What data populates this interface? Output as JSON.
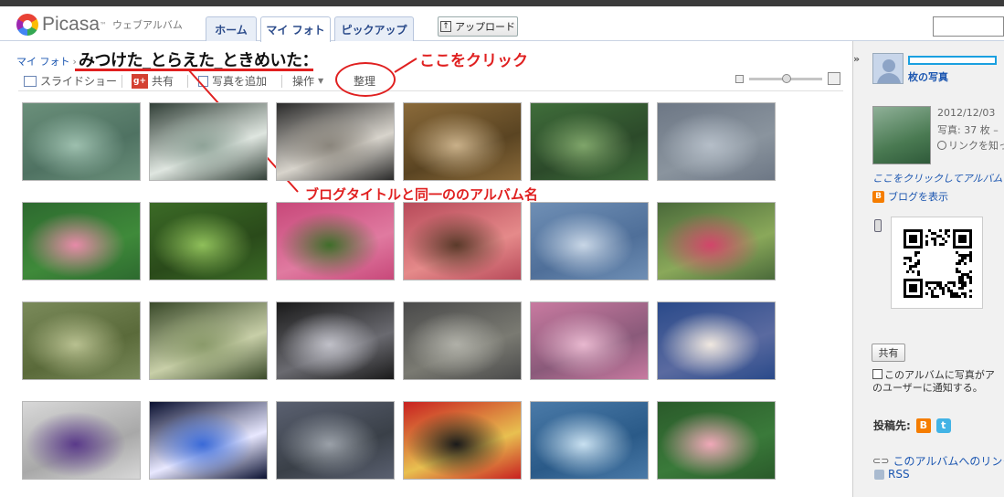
{
  "header": {
    "logo_text": "Picasa",
    "logo_tm": "™",
    "logo_sub": "ウェブアルバム",
    "tabs": [
      "ホーム",
      "マイ フォト",
      "ピックアップ"
    ],
    "upload_label": "アップロード"
  },
  "breadcrumb": {
    "root": "マイ フォト",
    "separator": "›"
  },
  "album": {
    "title": "みつけた_とらえた_ときめいた："
  },
  "toolbar": {
    "slideshow": "スライドショー",
    "share_icon": "g+",
    "share": "共有",
    "add_photos": "写真を追加",
    "actions": "操作",
    "organize": "整理"
  },
  "annotations": {
    "click_here": "ここをクリック",
    "blog_title_note": "ブログタイトルと同一ののアルバム名"
  },
  "photos": [
    {
      "desc": "green-stream",
      "colors": [
        "#6a8f7a",
        "#9dbfae",
        "#4f7262"
      ]
    },
    {
      "desc": "waterfall-splash",
      "colors": [
        "#324038",
        "#8fa398",
        "#dfe6e0"
      ]
    },
    {
      "desc": "rock-cascade",
      "colors": [
        "#2a2a2a",
        "#8a857c",
        "#d8d4cc"
      ]
    },
    {
      "desc": "golden-water",
      "colors": [
        "#8a6a3a",
        "#c9b089",
        "#5a4422"
      ]
    },
    {
      "desc": "reflecting-pond",
      "colors": [
        "#3f6d3a",
        "#7fa56a",
        "#2c4a2a"
      ]
    },
    {
      "desc": "cloud-reflection",
      "colors": [
        "#6d7785",
        "#b5bec8",
        "#8a949e"
      ]
    },
    {
      "desc": "pink-lotus",
      "colors": [
        "#2d6a2f",
        "#e78aa8",
        "#3f8a3a"
      ]
    },
    {
      "desc": "green-forest",
      "colors": [
        "#3b6a26",
        "#8fbf5a",
        "#2a4a1a"
      ]
    },
    {
      "desc": "azalea-bush",
      "colors": [
        "#c8487a",
        "#3f6e2a",
        "#e07aa0"
      ]
    },
    {
      "desc": "azalea-trunk",
      "colors": [
        "#b84a5a",
        "#5a3a2a",
        "#e58a8a"
      ]
    },
    {
      "desc": "cirrus-sky",
      "colors": [
        "#6f8fb5",
        "#c8d6e6",
        "#4f6f99"
      ]
    },
    {
      "desc": "hillside-blossoms",
      "colors": [
        "#4a6a3a",
        "#d2456a",
        "#8aa85a"
      ]
    },
    {
      "desc": "spring-trees",
      "colors": [
        "#7a8a5a",
        "#b8c090",
        "#5a6a3a"
      ]
    },
    {
      "desc": "mossy-branches",
      "colors": [
        "#3a4a2a",
        "#8a9a6a",
        "#c8cfa8"
      ]
    },
    {
      "desc": "petals-dark",
      "colors": [
        "#1a1a1a",
        "#c0c0c8",
        "#6a6a70"
      ]
    },
    {
      "desc": "petals-water",
      "colors": [
        "#4a4a4a",
        "#b0b0a8",
        "#7a7a72"
      ]
    },
    {
      "desc": "weeping-cherry",
      "colors": [
        "#c87aa0",
        "#e8b8cf",
        "#8a5a7a"
      ]
    },
    {
      "desc": "white-magnolia",
      "colors": [
        "#2a4a8a",
        "#f0e8e0",
        "#5a6aa0"
      ]
    },
    {
      "desc": "purple-ribbon",
      "colors": [
        "#d8d8d8",
        "#5a3a8a",
        "#a8a8a8"
      ]
    },
    {
      "desc": "castle-night",
      "colors": [
        "#0a1030",
        "#3a6ad8",
        "#e8e8ff"
      ]
    },
    {
      "desc": "shadows-pavement",
      "colors": [
        "#5a6070",
        "#9aa0a8",
        "#3a4048"
      ]
    },
    {
      "desc": "mickey-minnie",
      "colors": [
        "#c82020",
        "#1a1a1a",
        "#e8c050"
      ]
    },
    {
      "desc": "frosted-conifer",
      "colors": [
        "#4a7aa8",
        "#c8e0f0",
        "#2a5a88"
      ]
    },
    {
      "desc": "pink-camellia",
      "colors": [
        "#2a5a2a",
        "#f0a8b8",
        "#3a7a3a"
      ]
    }
  ],
  "sidebar": {
    "photo_count_label": "枚の写真",
    "date": "2012/12/03",
    "count": "写真: 37 枚 –",
    "link_only": "リンクを知っ",
    "click_link": "ここをクリックしてアルバムの",
    "view_blog": "ブログを表示",
    "share_button": "共有",
    "notify": "このアルバムに写真がアのユーザーに通知する。",
    "post_to": "投稿先:",
    "blogger_icon": "B",
    "twitter_icon": "t",
    "album_link": "このアルバムへのリンク",
    "rss": "RSS",
    "collapse": "»"
  },
  "colors": {
    "accent": "#1a55b0",
    "annotation": "#e02020",
    "highlight": "#1aa0e0"
  }
}
